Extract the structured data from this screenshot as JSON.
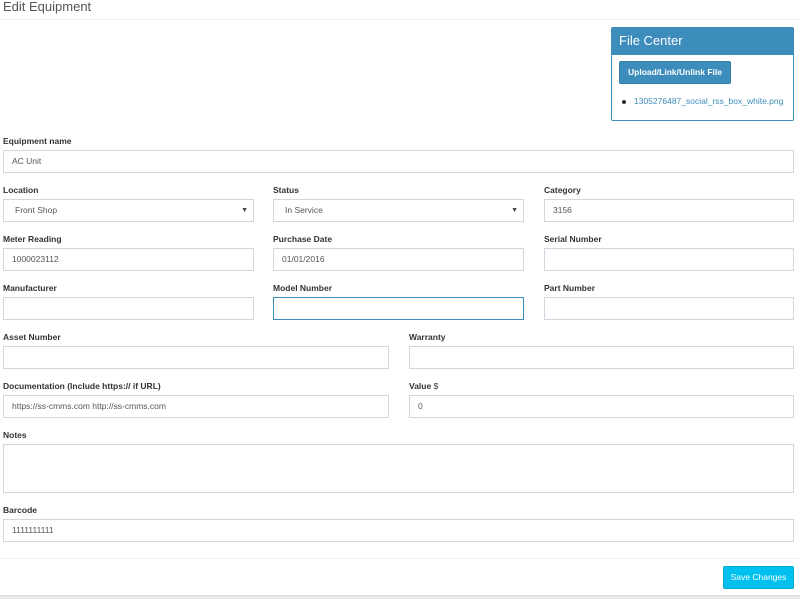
{
  "page": {
    "title": "Edit Equipment"
  },
  "file_center": {
    "title": "File Center",
    "button_label": "Upload/Link/Unlink File",
    "files": [
      "1305276487_social_rss_box_white.png"
    ]
  },
  "form": {
    "equipment_name": {
      "label": "Equipment name",
      "value": "AC Unit"
    },
    "location": {
      "label": "Location",
      "value": "Front Shop"
    },
    "status": {
      "label": "Status",
      "value": "In Service"
    },
    "category": {
      "label": "Category",
      "value": "3156"
    },
    "meter_reading": {
      "label": "Meter Reading",
      "value": "1000023112"
    },
    "purchase_date": {
      "label": "Purchase Date",
      "value": "01/01/2016"
    },
    "serial_number": {
      "label": "Serial Number",
      "value": ""
    },
    "manufacturer": {
      "label": "Manufacturer",
      "value": ""
    },
    "model_number": {
      "label": "Model Number",
      "value": ""
    },
    "part_number": {
      "label": "Part Number",
      "value": ""
    },
    "asset_number": {
      "label": "Asset Number",
      "value": ""
    },
    "warranty": {
      "label": "Warranty",
      "value": ""
    },
    "documentation": {
      "label": "Documentation (Include https:// if URL)",
      "value": "https://ss-cmms.com http://ss-cmms.com"
    },
    "value": {
      "label": "Value",
      "unit": "$",
      "value": "0"
    },
    "notes": {
      "label": "Notes",
      "value": ""
    },
    "barcode": {
      "label": "Barcode",
      "value": "1111111111"
    }
  },
  "actions": {
    "save_label": "Save Changes"
  },
  "colors": {
    "primary": "#3c8dbc",
    "info": "#00c0ef",
    "border": "#d2d6de"
  },
  "icons": {
    "select_caret": "caret-down-icon",
    "list_bullet": "bullet-icon"
  }
}
